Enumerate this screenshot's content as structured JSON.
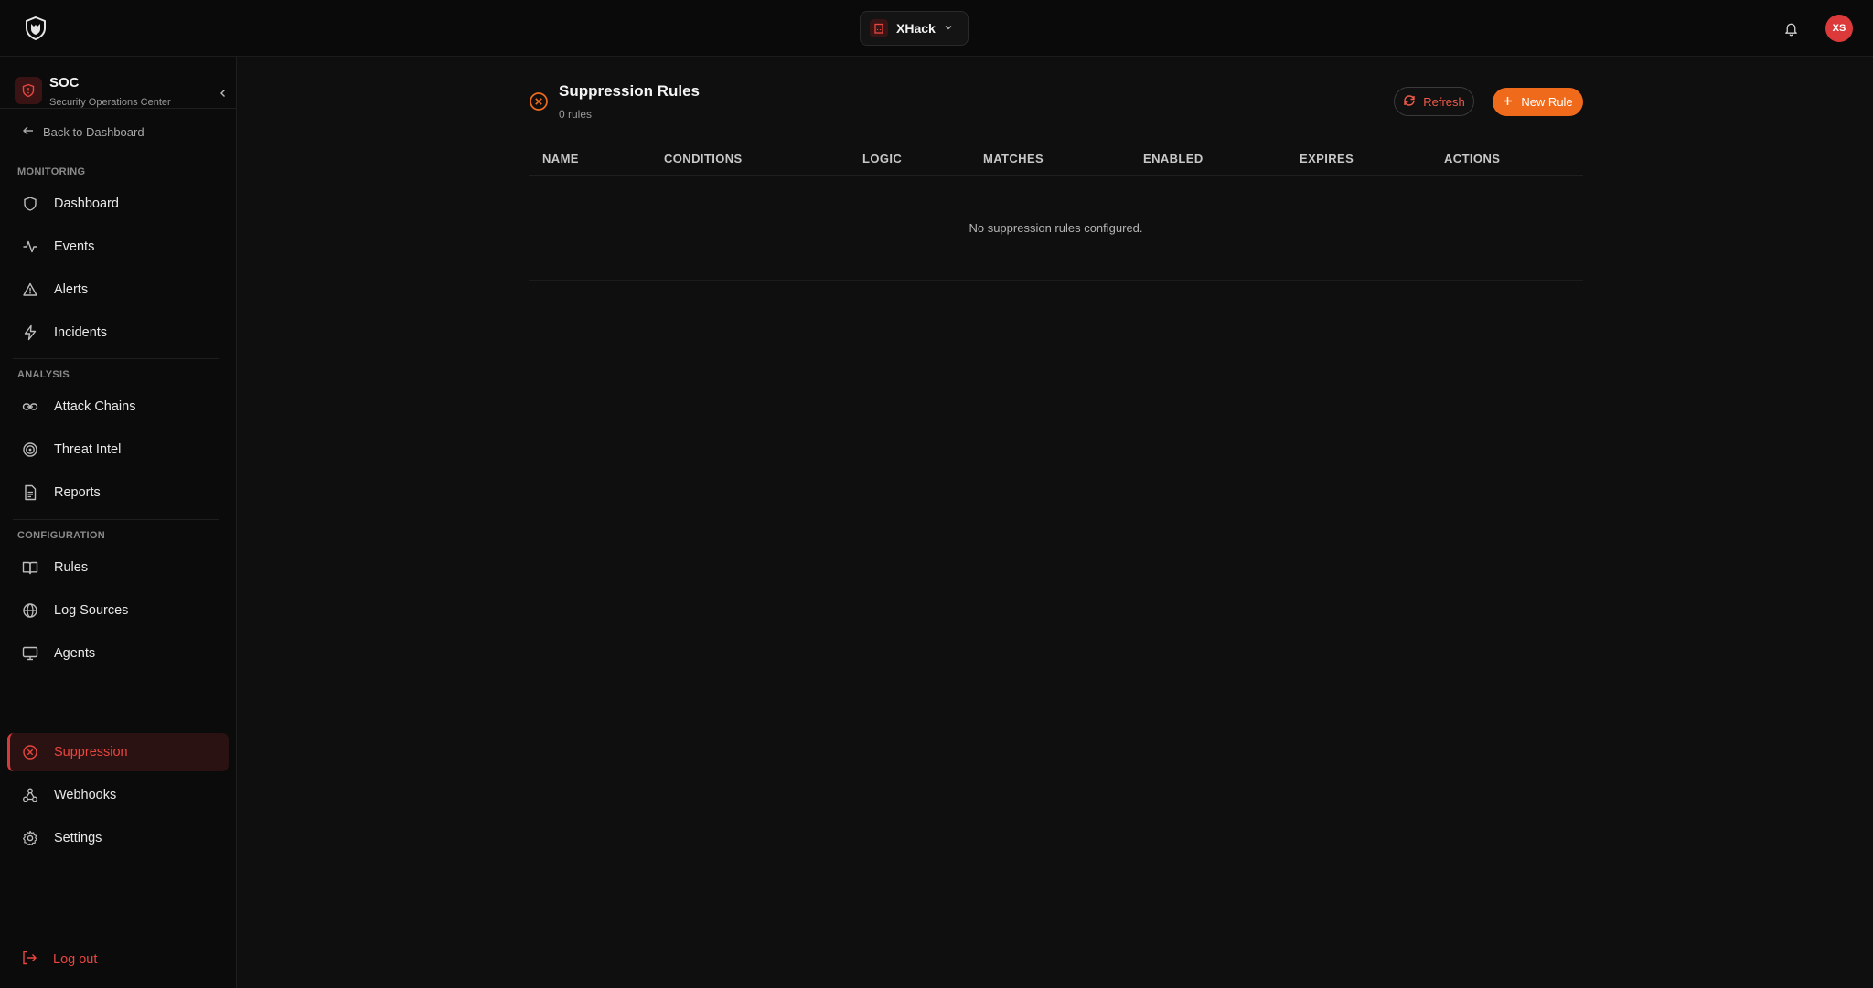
{
  "org": {
    "name": "XHack"
  },
  "user": {
    "initials": "XS"
  },
  "brand": {
    "title": "SOC",
    "subtitle": "Security Operations Center"
  },
  "sidebar": {
    "back_label": "Back to Dashboard",
    "sections": [
      {
        "label": "MONITORING",
        "items": [
          {
            "label": "Dashboard",
            "icon": "shield-icon"
          },
          {
            "label": "Events",
            "icon": "activity-icon"
          },
          {
            "label": "Alerts",
            "icon": "warning-triangle-icon"
          },
          {
            "label": "Incidents",
            "icon": "lightning-icon"
          }
        ]
      },
      {
        "label": "ANALYSIS",
        "items": [
          {
            "label": "Attack Chains",
            "icon": "link-icon"
          },
          {
            "label": "Threat Intel",
            "icon": "target-icon"
          },
          {
            "label": "Reports",
            "icon": "document-icon"
          }
        ]
      },
      {
        "label": "CONFIGURATION",
        "items": [
          {
            "label": "Rules",
            "icon": "book-icon"
          },
          {
            "label": "Log Sources",
            "icon": "globe-icon"
          },
          {
            "label": "Agents",
            "icon": "monitor-icon"
          },
          {
            "label": "Suppression",
            "icon": "x-circle-icon",
            "active": true
          },
          {
            "label": "Webhooks",
            "icon": "webhook-icon"
          },
          {
            "label": "Settings",
            "icon": "gear-icon"
          }
        ]
      }
    ],
    "logout_label": "Log out"
  },
  "main": {
    "title": "Suppression Rules",
    "count": "0 rules",
    "refresh_label": "Refresh",
    "new_rule_label": "New Rule",
    "columns": [
      "NAME",
      "CONDITIONS",
      "LOGIC",
      "MATCHES",
      "ENABLED",
      "EXPIRES",
      "ACTIONS"
    ],
    "empty_message": "No suppression rules configured."
  },
  "colors": {
    "accent_red": "#e8463f",
    "accent_orange": "#f06a1c",
    "background": "#0f0f0f"
  }
}
